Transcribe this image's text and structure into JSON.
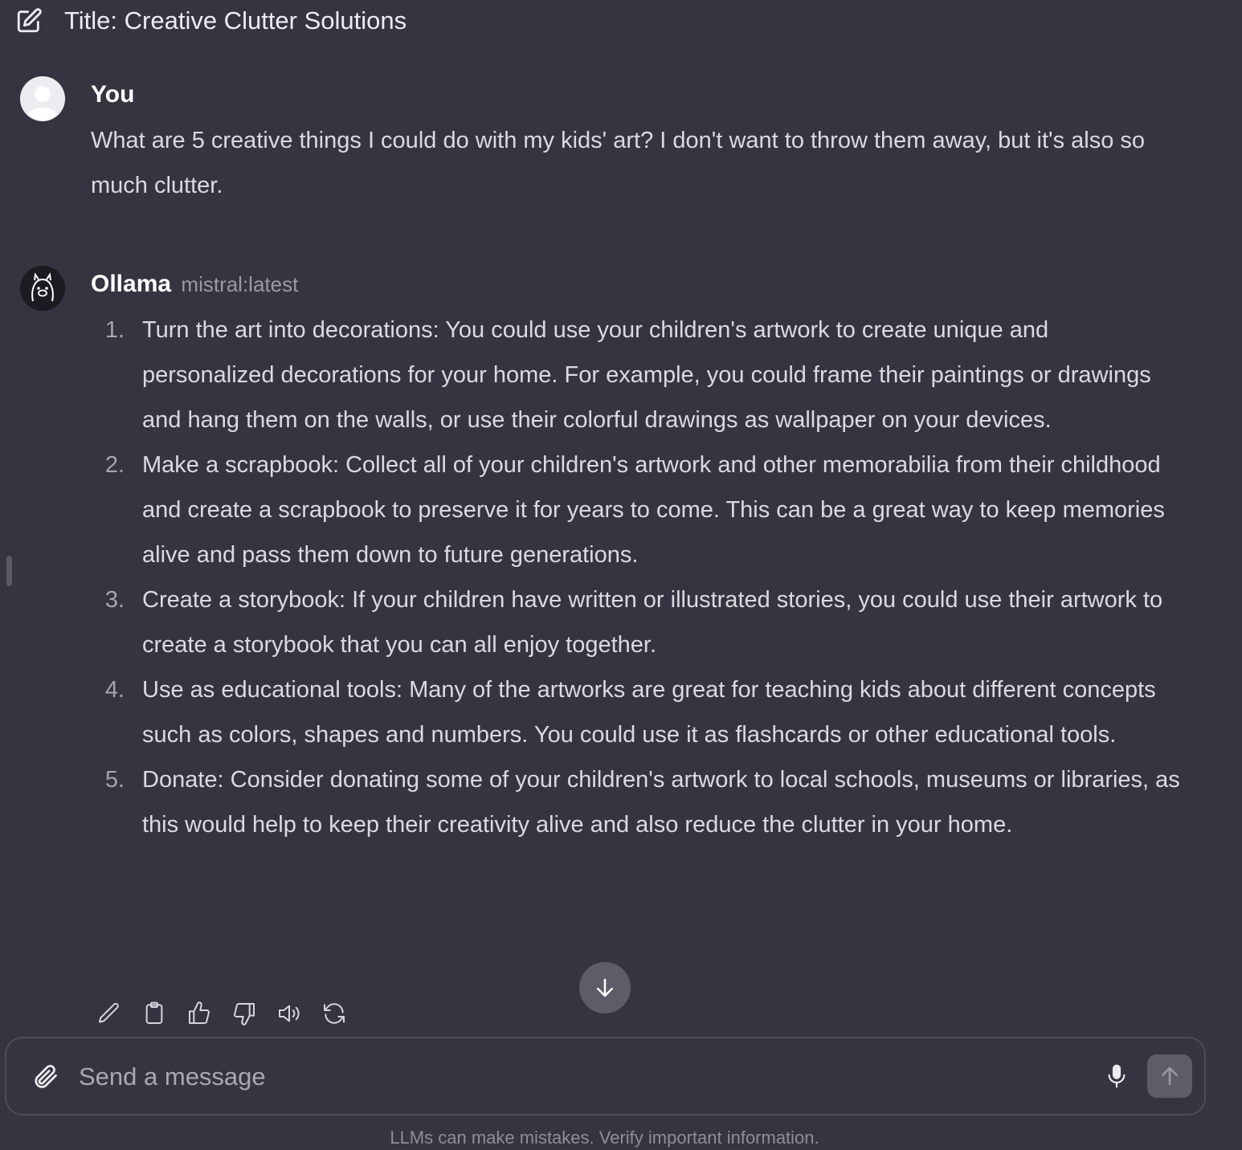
{
  "header": {
    "title": "Title: Creative Clutter Solutions",
    "new_chat_icon": "edit-icon"
  },
  "user_message": {
    "author": "You",
    "text": "What are 5 creative things I could do with my kids' art? I don't want to throw them away, but it's also so much clutter."
  },
  "assistant_message": {
    "author": "Ollama",
    "model": "mistral:latest",
    "items": [
      {
        "num": "1.",
        "text": "Turn the art into decorations: You could use your children's artwork to create unique and personalized decorations for your home. For example, you could frame their paintings or drawings and hang them on the walls, or use their colorful drawings as wallpaper on your devices."
      },
      {
        "num": "2.",
        "text": "Make a scrapbook: Collect all of your children's artwork and other memorabilia from their childhood and create a scrapbook to preserve it for years to come. This can be a great way to keep memories alive and pass them down to future generations."
      },
      {
        "num": "3.",
        "text": "Create a storybook: If your children have written or illustrated stories, you could use their artwork to create a storybook that you can all enjoy together."
      },
      {
        "num": "4.",
        "text": "Use as educational tools: Many of the artworks are great for teaching kids about different concepts such as colors, shapes and numbers. You could use it as flashcards or other educational tools."
      },
      {
        "num": "5.",
        "text": "Donate: Consider donating some of your children's artwork to local schools, museums or libraries, as this would help to keep their creativity alive and also reduce the clutter in your home."
      }
    ],
    "actions": [
      "edit-icon",
      "copy-icon",
      "thumbs-up-icon",
      "thumbs-down-icon",
      "speaker-icon",
      "regenerate-icon"
    ]
  },
  "composer": {
    "placeholder": "Send a message",
    "value": ""
  },
  "footer": {
    "disclaimer": "LLMs can make mistakes. Verify important information."
  },
  "colors": {
    "background": "#353542",
    "text": "#ececf1",
    "muted": "#8e8e99",
    "button_bg": "#5d5d69"
  }
}
